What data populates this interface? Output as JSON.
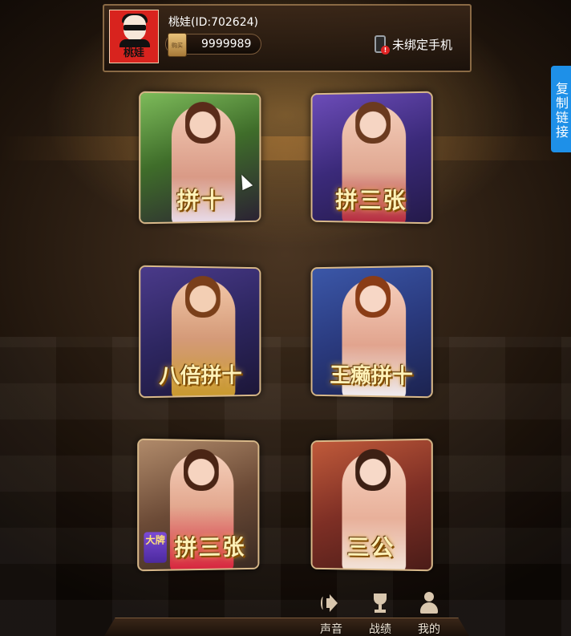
{
  "header": {
    "avatar_text": "桃娃",
    "username": "桃娃(ID:702624)",
    "coin_icon_text": "购买",
    "coins": "9999989",
    "phone_status": "未绑定手机",
    "phone_badge": "!"
  },
  "side_tab": {
    "copy_link": "复制链接"
  },
  "games": [
    {
      "title": "拼十"
    },
    {
      "title": "拼三张"
    },
    {
      "title": "八倍拼十"
    },
    {
      "title": "王癞拼十"
    },
    {
      "title": "拼三张",
      "badge": "大牌"
    },
    {
      "title": "三公"
    }
  ],
  "nav": {
    "sound": "声音",
    "record": "战绩",
    "mine": "我的"
  },
  "icons": [
    "avatar",
    "coin-icon",
    "phone-icon",
    "speaker-icon",
    "trophy-icon",
    "person-icon",
    "cursor-icon"
  ]
}
